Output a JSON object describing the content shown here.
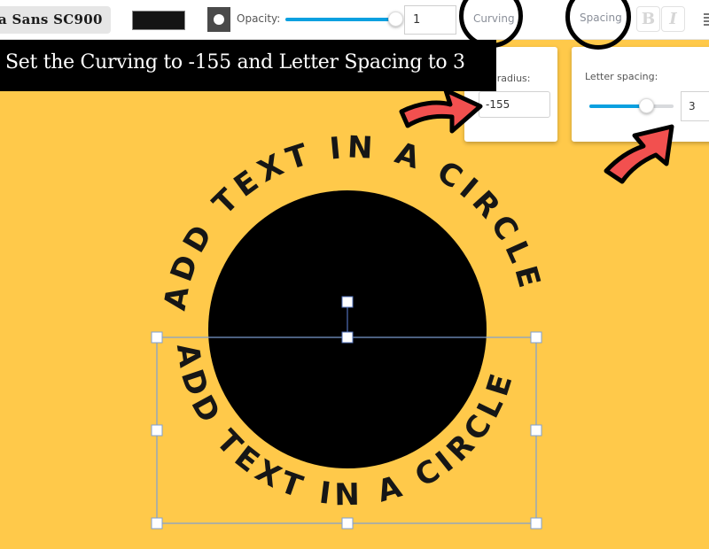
{
  "toolbar": {
    "font_name": "a Sans SC900",
    "text_color": "#141414",
    "opacity_label": "Opacity:",
    "opacity_value": "1",
    "opacity_fraction": 1.0,
    "tab_curving": "Curving",
    "tab_spacing": "Spacing",
    "bold_label": "B",
    "italic_label": "I"
  },
  "instruction": {
    "text": "Set the Curving to -155 and Letter Spacing to 3"
  },
  "curving_panel": {
    "label": "ve radius:",
    "value": "-155"
  },
  "spacing_panel": {
    "label": "Letter spacing:",
    "value": "3",
    "slider_fraction": 0.67
  },
  "canvas": {
    "background_color": "#ffc94a",
    "circle_color": "#000000",
    "top_arc_text": "ADD TEXT IN A CIRCLE",
    "bottom_arc_text": "ADD TEXT IN A CIRCLE",
    "accent_color": "#0aa0e0",
    "arrow_color": "#f2504f"
  }
}
